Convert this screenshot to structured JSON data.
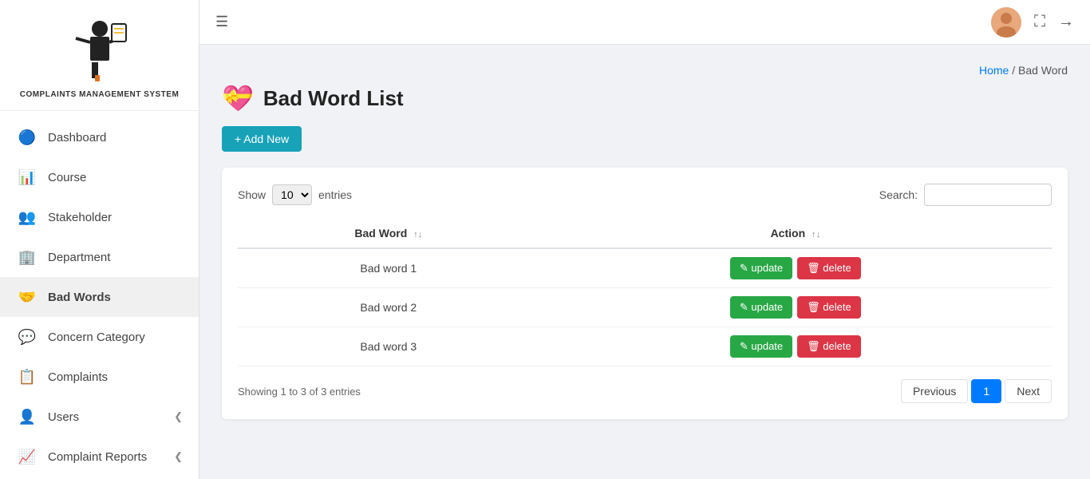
{
  "app": {
    "title": "Complaints Management System",
    "logo_text": "COMPLAINTS MANAGEMENT\nSYSTEM"
  },
  "topbar": {
    "hamburger_label": "☰",
    "avatar_emoji": "👤",
    "fullscreen_icon": "⛶",
    "logout_icon": "→"
  },
  "breadcrumb": {
    "home_label": "Home",
    "separator": " / ",
    "current": "Bad Word"
  },
  "page": {
    "icon": "💝",
    "title": "Bad Word List",
    "add_button_label": "+ Add New"
  },
  "table_controls": {
    "show_label": "Show",
    "show_value": "10",
    "entries_label": "entries",
    "search_label": "Search:",
    "search_placeholder": ""
  },
  "table": {
    "columns": [
      {
        "key": "bad_word",
        "label": "Bad Word",
        "sortable": true,
        "align": "center"
      },
      {
        "key": "action",
        "label": "Action",
        "sortable": false,
        "align": "center"
      }
    ],
    "rows": [
      {
        "id": 1,
        "bad_word": "Bad word 1"
      },
      {
        "id": 2,
        "bad_word": "Bad word 2"
      },
      {
        "id": 3,
        "bad_word": "Bad word 3"
      }
    ],
    "action_update": "update",
    "action_delete": "delete"
  },
  "table_footer": {
    "showing_text": "Showing 1 to 3 of 3 entries",
    "prev_label": "Previous",
    "page_label": "1",
    "next_label": "Next"
  },
  "nav": {
    "items": [
      {
        "id": "dashboard",
        "label": "Dashboard",
        "icon": "🔵"
      },
      {
        "id": "course",
        "label": "Course",
        "icon": "📊"
      },
      {
        "id": "stakeholder",
        "label": "Stakeholder",
        "icon": "👥"
      },
      {
        "id": "department",
        "label": "Department",
        "icon": "🏢"
      },
      {
        "id": "bad-words",
        "label": "Bad Words",
        "icon": "🧑‍🤝‍🧑",
        "active": true
      },
      {
        "id": "concern-category",
        "label": "Concern Category",
        "icon": "💬"
      },
      {
        "id": "complaints",
        "label": "Complaints",
        "icon": "📋"
      },
      {
        "id": "users",
        "label": "Users",
        "icon": "👤",
        "has_arrow": true
      },
      {
        "id": "complaint-reports",
        "label": "Complaint Reports",
        "icon": "📈",
        "has_arrow": true
      }
    ]
  }
}
